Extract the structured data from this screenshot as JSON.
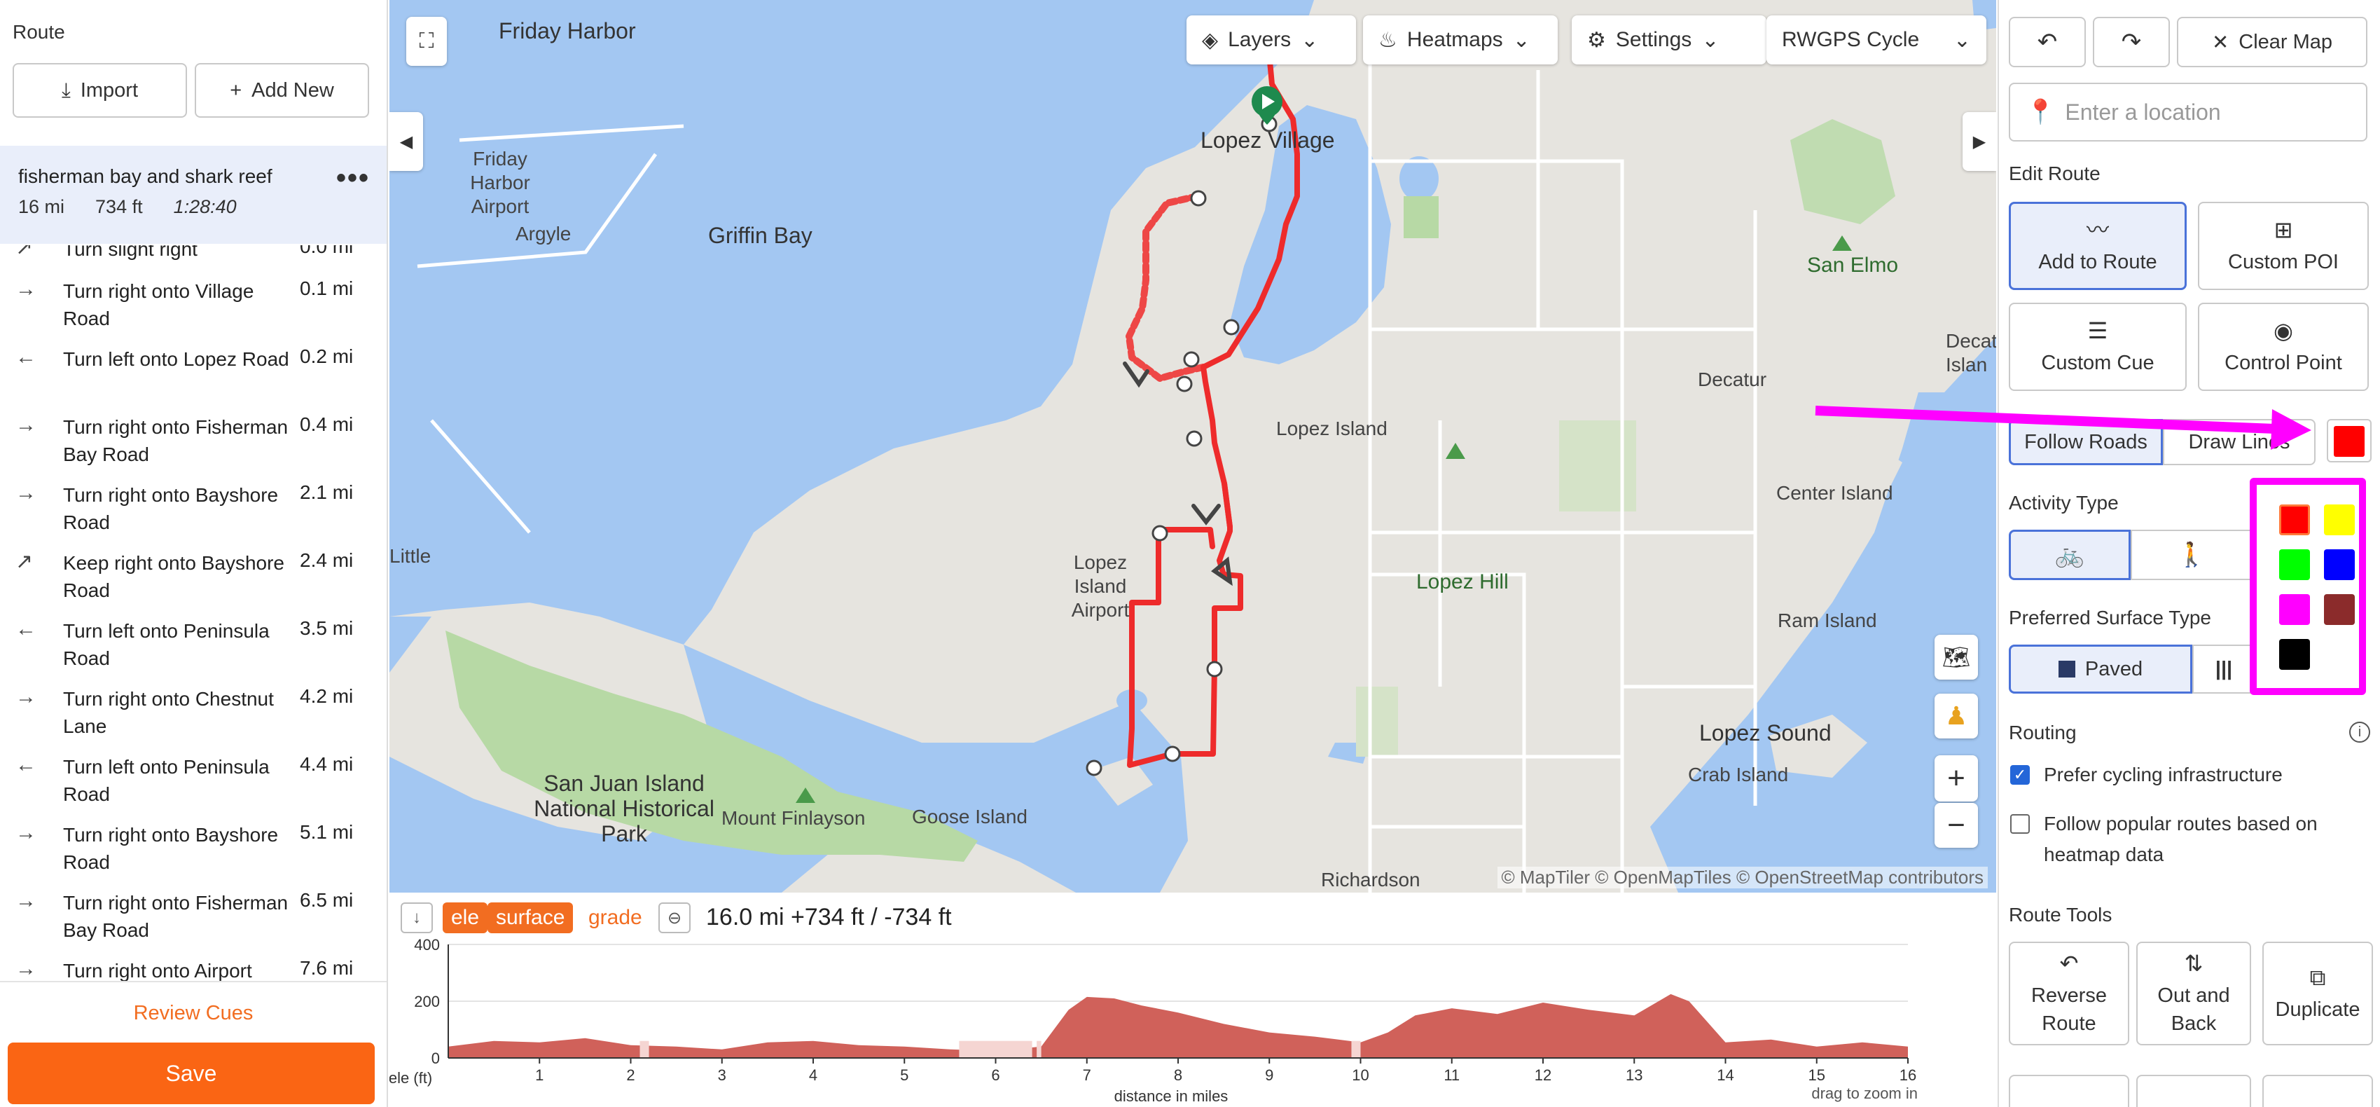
{
  "left": {
    "section_label": "Route",
    "import_label": "Import",
    "add_new_label": "Add New",
    "route_name": "fisherman bay and shark reef",
    "route_distance": "16 mi",
    "route_elevation": "734 ft",
    "route_time": "1:28:40",
    "more_label": "•••",
    "partial_cue": {
      "text": "Turn slight right",
      "distance": "0.0 mi"
    },
    "cues": [
      {
        "arrow": "→",
        "text": "Turn right onto Village Road",
        "distance": "0.1 mi"
      },
      {
        "arrow": "←",
        "text": "Turn left onto Lopez Road",
        "distance": "0.2 mi"
      },
      {
        "arrow": "→",
        "text": "Turn right onto Fisherman Bay Road",
        "distance": "0.4 mi"
      },
      {
        "arrow": "→",
        "text": "Turn right onto Bayshore Road",
        "distance": "2.1 mi"
      },
      {
        "arrow": "↗",
        "text": "Keep right onto Bayshore Road",
        "distance": "2.4 mi"
      },
      {
        "arrow": "←",
        "text": "Turn left onto Peninsula Road",
        "distance": "3.5 mi"
      },
      {
        "arrow": "→",
        "text": "Turn right onto Chestnut Lane",
        "distance": "4.2 mi"
      },
      {
        "arrow": "←",
        "text": "Turn left onto Peninsula Road",
        "distance": "4.4 mi"
      },
      {
        "arrow": "→",
        "text": "Turn right onto Bayshore Road",
        "distance": "5.1 mi"
      },
      {
        "arrow": "→",
        "text": "Turn right onto Fisherman Bay Road",
        "distance": "6.5 mi"
      },
      {
        "arrow": "→",
        "text": "Turn right onto Airport",
        "distance": "7.6 mi"
      }
    ],
    "review_label": "Review Cues",
    "save_label": "Save"
  },
  "map": {
    "layers_label": "Layers",
    "heatmaps_label": "Heatmaps",
    "settings_label": "Settings",
    "basemap_label": "RWGPS Cycle",
    "attribution": "© MapTiler © OpenMapTiles © OpenStreetMap contributors",
    "labels": {
      "friday_harbor": "Friday Harbor",
      "fh_airport": "Friday Harbor Airport",
      "argyle": "Argyle",
      "griffin_bay": "Griffin Bay",
      "lopez_village": "Lopez Village",
      "lopez_island": "Lopez Island",
      "lopez_airport": "Lopez Island Airport",
      "lopez_hill": "Lopez Hill",
      "san_elmo": "San Elmo",
      "decatur": "Decatur",
      "decatur_island": "Decat Islan",
      "center_island": "Center Island",
      "ram_island": "Ram Island",
      "lopez_sound": "Lopez Sound",
      "crab_island": "Crab Island",
      "little": "Little",
      "sj_park": "San Juan Island National Historical Park",
      "mt_finlayson": "Mount Finlayson",
      "goose_island": "Goose Island",
      "richardson": "Richardson"
    },
    "colors": {
      "water": "#a3c7f2",
      "land": "#e6e4df",
      "park": "#b7d9a5",
      "route": "#ee2b2b",
      "annotation": "#ff00ff"
    }
  },
  "elevation": {
    "ele_label": "ele",
    "surface_label": "surface",
    "grade_label": "grade",
    "summary": "16.0 mi +734 ft / -734 ft",
    "y_axis_label": "ele (ft)",
    "x_axis_label": "distance in miles",
    "hint": "drag to zoom in",
    "y_ticks": [
      "400",
      "200",
      "0"
    ],
    "x_ticks": [
      "1",
      "2",
      "3",
      "4",
      "5",
      "6",
      "7",
      "8",
      "9",
      "10",
      "11",
      "12",
      "13",
      "14",
      "15",
      "16"
    ]
  },
  "chart_data": {
    "type": "area",
    "x": [
      0,
      0.5,
      1,
      1.5,
      2,
      2.5,
      3,
      3.5,
      4,
      4.5,
      5,
      5.5,
      6,
      6.5,
      6.8,
      7,
      7.3,
      7.6,
      8,
      8.5,
      9,
      9.5,
      10,
      10.3,
      10.6,
      11,
      11.5,
      12,
      12.5,
      13,
      13.4,
      13.6,
      14,
      14.5,
      15,
      15.5,
      16
    ],
    "values": [
      40,
      60,
      55,
      70,
      45,
      40,
      30,
      55,
      60,
      45,
      40,
      30,
      25,
      40,
      170,
      215,
      210,
      185,
      160,
      120,
      90,
      75,
      55,
      90,
      150,
      175,
      155,
      195,
      170,
      150,
      225,
      200,
      55,
      65,
      40,
      55,
      40
    ],
    "xlabel": "distance in miles",
    "ylabel": "ele (ft)",
    "xlim": [
      0,
      16
    ],
    "ylim": [
      0,
      400
    ]
  },
  "right": {
    "undo_label": "↶",
    "redo_label": "↷",
    "clear_label": "Clear Map",
    "location_placeholder": "Enter a location",
    "edit_route_label": "Edit Route",
    "add_to_route_label": "Add to Route",
    "custom_poi_label": "Custom POI",
    "custom_cue_label": "Custom Cue",
    "control_point_label": "Control Point",
    "follow_roads_label": "Follow Roads",
    "draw_lines_label": "Draw Lines",
    "activity_type_label": "Activity Type",
    "surface_type_label": "Preferred Surface Type",
    "paved_label": "Paved",
    "routing_label": "Routing",
    "prefer_cycling_label": "Prefer cycling infrastructure",
    "follow_popular_label": "Follow popular routes based on heatmap data",
    "route_tools_label": "Route Tools",
    "reverse_label": "Reverse Route",
    "out_back_label": "Out and Back",
    "duplicate_label": "Duplicate",
    "swatch_colors": [
      "#ff0000",
      "#ffff00",
      "#00ff00",
      "#0000ff",
      "#ff00ff",
      "#8b2b2b",
      "#000000"
    ],
    "selected_color": "#ff0000"
  }
}
